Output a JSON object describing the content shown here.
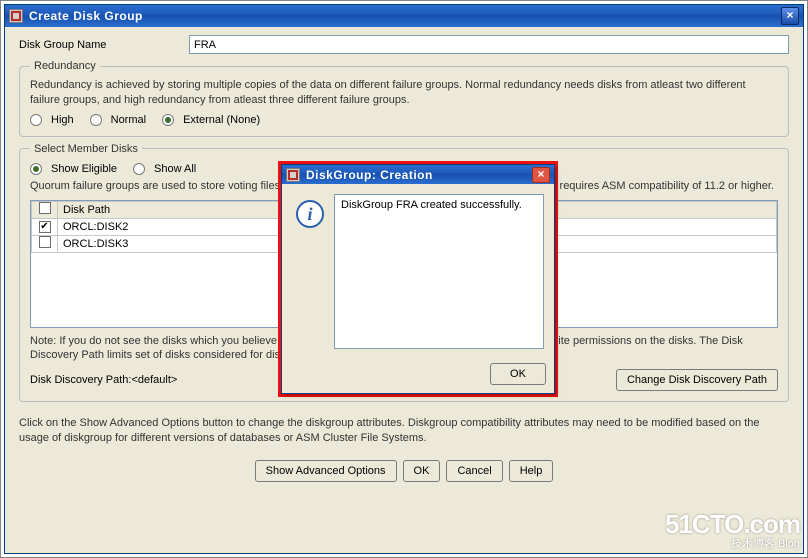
{
  "title": "Create Disk Group",
  "diskGroup": {
    "label": "Disk Group Name",
    "value": "FRA"
  },
  "redundancy": {
    "legend": "Redundancy",
    "desc": "Redundancy is achieved by storing multiple copies of the data on different failure groups. Normal redundancy needs disks from atleast two different failure groups, and high redundancy from atleast three different failure groups.",
    "options": {
      "high": "High",
      "normal": "Normal",
      "external": "External (None)"
    },
    "selected": "external"
  },
  "memberDisks": {
    "legend": "Select Member Disks",
    "showEligible": "Show Eligible",
    "showAll": "Show All",
    "showSelected": "eligible",
    "quorumDesc": "Quorum failure groups are used to store voting files in extended clusters and do not contain any user data. It requires ASM compatibility of 11.2 or higher.",
    "header": "Disk Path",
    "rows": [
      {
        "checked": true,
        "path": "ORCL:DISK2"
      },
      {
        "checked": false,
        "path": "ORCL:DISK3"
      }
    ],
    "note": "Note: If you do not see the disks which you believe are available, check the Disk Discovery Path and read/write permissions on the disks. The Disk Discovery Path limits set of disks considered for discovery.",
    "pathLabel": "Disk Discovery Path:<default>",
    "changeBtn": "Change Disk Discovery Path"
  },
  "footerText": "Click on the Show Advanced Options button to change the diskgroup attributes. Diskgroup compatibility attributes may need to be modified based on the usage of diskgroup for different versions of databases or ASM Cluster File Systems.",
  "buttons": {
    "advanced": "Show Advanced Options",
    "ok": "OK",
    "cancel": "Cancel",
    "help": "Help"
  },
  "modal": {
    "title": "DiskGroup: Creation",
    "message": "DiskGroup FRA created successfully.",
    "ok": "OK"
  },
  "watermark": {
    "line1": "51CTO.com",
    "line2": "技术博客   Blog"
  }
}
